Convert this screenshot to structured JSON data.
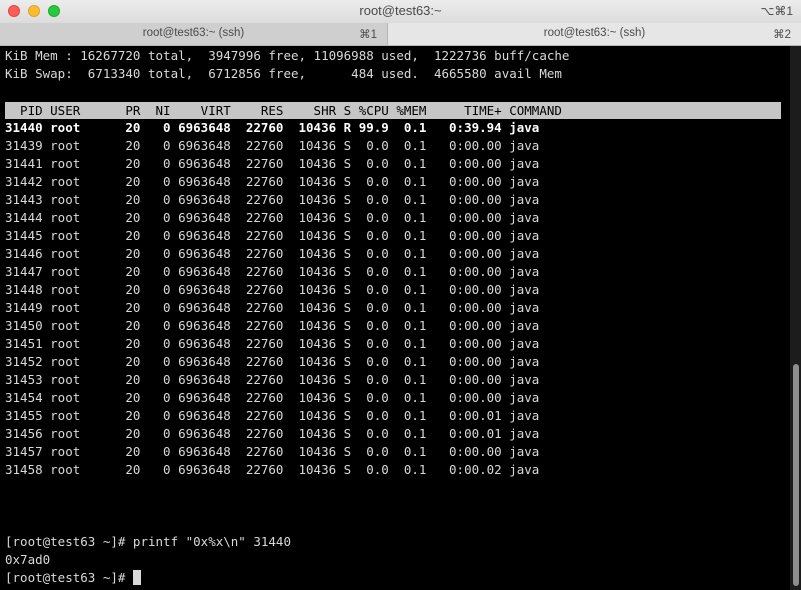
{
  "window": {
    "title": "root@test63:~",
    "shortcut": "⌥⌘1"
  },
  "tabs": [
    {
      "label": "root@test63:~ (ssh)",
      "shortcut": "⌘1"
    },
    {
      "label": "root@test63:~ (ssh)",
      "shortcut": "⌘2"
    }
  ],
  "summary": {
    "mem_line": "KiB Mem : 16267720 total,  3947996 free, 11096988 used,  1222736 buff/cache",
    "swap_line": "KiB Swap:  6713340 total,  6712856 free,      484 used.  4665580 avail Mem"
  },
  "table": {
    "header": "  PID USER      PR  NI    VIRT    RES    SHR S %CPU %MEM     TIME+ COMMAND",
    "rows": [
      "31440 root      20   0 6963648  22760  10436 R 99.9  0.1   0:39.94 java",
      "31439 root      20   0 6963648  22760  10436 S  0.0  0.1   0:00.00 java",
      "31441 root      20   0 6963648  22760  10436 S  0.0  0.1   0:00.00 java",
      "31442 root      20   0 6963648  22760  10436 S  0.0  0.1   0:00.00 java",
      "31443 root      20   0 6963648  22760  10436 S  0.0  0.1   0:00.00 java",
      "31444 root      20   0 6963648  22760  10436 S  0.0  0.1   0:00.00 java",
      "31445 root      20   0 6963648  22760  10436 S  0.0  0.1   0:00.00 java",
      "31446 root      20   0 6963648  22760  10436 S  0.0  0.1   0:00.00 java",
      "31447 root      20   0 6963648  22760  10436 S  0.0  0.1   0:00.00 java",
      "31448 root      20   0 6963648  22760  10436 S  0.0  0.1   0:00.00 java",
      "31449 root      20   0 6963648  22760  10436 S  0.0  0.1   0:00.00 java",
      "31450 root      20   0 6963648  22760  10436 S  0.0  0.1   0:00.00 java",
      "31451 root      20   0 6963648  22760  10436 S  0.0  0.1   0:00.00 java",
      "31452 root      20   0 6963648  22760  10436 S  0.0  0.1   0:00.00 java",
      "31453 root      20   0 6963648  22760  10436 S  0.0  0.1   0:00.00 java",
      "31454 root      20   0 6963648  22760  10436 S  0.0  0.1   0:00.00 java",
      "31455 root      20   0 6963648  22760  10436 S  0.0  0.1   0:00.01 java",
      "31456 root      20   0 6963648  22760  10436 S  0.0  0.1   0:00.01 java",
      "31457 root      20   0 6963648  22760  10436 S  0.0  0.1   0:00.00 java",
      "31458 root      20   0 6963648  22760  10436 S  0.0  0.1   0:00.02 java"
    ]
  },
  "shell": {
    "command_line": "[root@test63 ~]# printf \"0x%x\\n\" 31440",
    "output": "0x7ad0",
    "prompt": "[root@test63 ~]# "
  },
  "colors": {
    "background": "#000000",
    "text": "#d9d9d9",
    "header_bar": "#c6c6c6"
  }
}
